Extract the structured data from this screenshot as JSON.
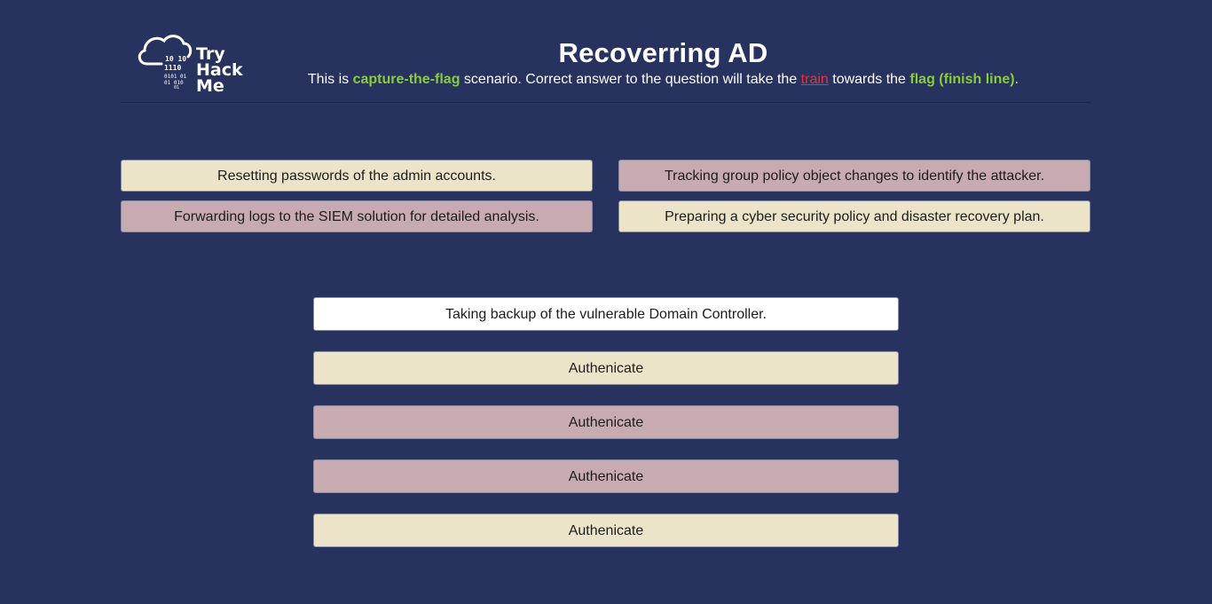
{
  "logo": {
    "word1": "Try",
    "word2": "Hack",
    "word3": "Me",
    "binary": [
      "10 10",
      "1110",
      "0101 01",
      "01 010",
      "01"
    ],
    "icon": "cloud-icon"
  },
  "header": {
    "title": "Recoverring AD",
    "subtitle_pre": "This is ",
    "subtitle_ctf": "capture-the-flag",
    "subtitle_mid1": " scenario. Correct answer to the question will take the ",
    "subtitle_train": "train",
    "subtitle_mid2": " towards the ",
    "subtitle_flag": "flag (finish line)",
    "subtitle_end": "."
  },
  "options": [
    {
      "label": "Resetting passwords of the admin accounts.",
      "color": "#ece4c8"
    },
    {
      "label": "Tracking group policy object changes to identify the attacker.",
      "color": "#c8abb0"
    },
    {
      "label": "Forwarding logs to the SIEM solution for detailed analysis.",
      "color": "#c8abb0"
    },
    {
      "label": "Preparing a cyber security policy and disaster recovery plan.",
      "color": "#ece4c8"
    }
  ],
  "answers": [
    {
      "label": "Taking backup of the vulnerable Domain Controller.",
      "color": "#ffffff"
    },
    {
      "label": "Authenicate",
      "color": "#ece4c8"
    },
    {
      "label": "Authenicate",
      "color": "#c8abb0"
    },
    {
      "label": "Authenicate",
      "color": "#c8abb0"
    },
    {
      "label": "Authenicate",
      "color": "#ece4c8"
    }
  ],
  "colors": {
    "background": "#27325f",
    "accent_green": "#88cc3b",
    "accent_red": "#e5333a"
  }
}
